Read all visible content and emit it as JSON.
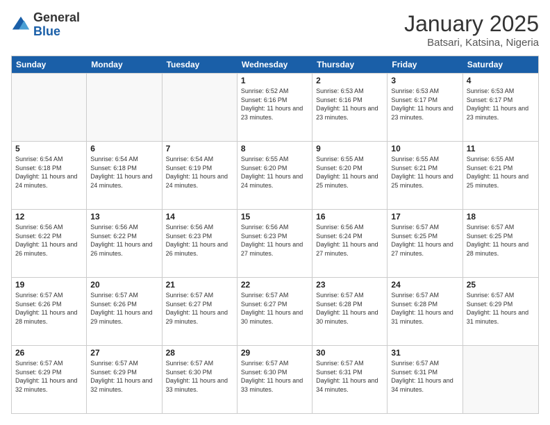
{
  "logo": {
    "general": "General",
    "blue": "Blue"
  },
  "header": {
    "title": "January 2025",
    "subtitle": "Batsari, Katsina, Nigeria"
  },
  "days": [
    "Sunday",
    "Monday",
    "Tuesday",
    "Wednesday",
    "Thursday",
    "Friday",
    "Saturday"
  ],
  "weeks": [
    [
      {
        "date": "",
        "sunrise": "",
        "sunset": "",
        "daylight": ""
      },
      {
        "date": "",
        "sunrise": "",
        "sunset": "",
        "daylight": ""
      },
      {
        "date": "",
        "sunrise": "",
        "sunset": "",
        "daylight": ""
      },
      {
        "date": "1",
        "sunrise": "Sunrise: 6:52 AM",
        "sunset": "Sunset: 6:16 PM",
        "daylight": "Daylight: 11 hours and 23 minutes."
      },
      {
        "date": "2",
        "sunrise": "Sunrise: 6:53 AM",
        "sunset": "Sunset: 6:16 PM",
        "daylight": "Daylight: 11 hours and 23 minutes."
      },
      {
        "date": "3",
        "sunrise": "Sunrise: 6:53 AM",
        "sunset": "Sunset: 6:17 PM",
        "daylight": "Daylight: 11 hours and 23 minutes."
      },
      {
        "date": "4",
        "sunrise": "Sunrise: 6:53 AM",
        "sunset": "Sunset: 6:17 PM",
        "daylight": "Daylight: 11 hours and 23 minutes."
      }
    ],
    [
      {
        "date": "5",
        "sunrise": "Sunrise: 6:54 AM",
        "sunset": "Sunset: 6:18 PM",
        "daylight": "Daylight: 11 hours and 24 minutes."
      },
      {
        "date": "6",
        "sunrise": "Sunrise: 6:54 AM",
        "sunset": "Sunset: 6:18 PM",
        "daylight": "Daylight: 11 hours and 24 minutes."
      },
      {
        "date": "7",
        "sunrise": "Sunrise: 6:54 AM",
        "sunset": "Sunset: 6:19 PM",
        "daylight": "Daylight: 11 hours and 24 minutes."
      },
      {
        "date": "8",
        "sunrise": "Sunrise: 6:55 AM",
        "sunset": "Sunset: 6:20 PM",
        "daylight": "Daylight: 11 hours and 24 minutes."
      },
      {
        "date": "9",
        "sunrise": "Sunrise: 6:55 AM",
        "sunset": "Sunset: 6:20 PM",
        "daylight": "Daylight: 11 hours and 25 minutes."
      },
      {
        "date": "10",
        "sunrise": "Sunrise: 6:55 AM",
        "sunset": "Sunset: 6:21 PM",
        "daylight": "Daylight: 11 hours and 25 minutes."
      },
      {
        "date": "11",
        "sunrise": "Sunrise: 6:55 AM",
        "sunset": "Sunset: 6:21 PM",
        "daylight": "Daylight: 11 hours and 25 minutes."
      }
    ],
    [
      {
        "date": "12",
        "sunrise": "Sunrise: 6:56 AM",
        "sunset": "Sunset: 6:22 PM",
        "daylight": "Daylight: 11 hours and 26 minutes."
      },
      {
        "date": "13",
        "sunrise": "Sunrise: 6:56 AM",
        "sunset": "Sunset: 6:22 PM",
        "daylight": "Daylight: 11 hours and 26 minutes."
      },
      {
        "date": "14",
        "sunrise": "Sunrise: 6:56 AM",
        "sunset": "Sunset: 6:23 PM",
        "daylight": "Daylight: 11 hours and 26 minutes."
      },
      {
        "date": "15",
        "sunrise": "Sunrise: 6:56 AM",
        "sunset": "Sunset: 6:23 PM",
        "daylight": "Daylight: 11 hours and 27 minutes."
      },
      {
        "date": "16",
        "sunrise": "Sunrise: 6:56 AM",
        "sunset": "Sunset: 6:24 PM",
        "daylight": "Daylight: 11 hours and 27 minutes."
      },
      {
        "date": "17",
        "sunrise": "Sunrise: 6:57 AM",
        "sunset": "Sunset: 6:25 PM",
        "daylight": "Daylight: 11 hours and 27 minutes."
      },
      {
        "date": "18",
        "sunrise": "Sunrise: 6:57 AM",
        "sunset": "Sunset: 6:25 PM",
        "daylight": "Daylight: 11 hours and 28 minutes."
      }
    ],
    [
      {
        "date": "19",
        "sunrise": "Sunrise: 6:57 AM",
        "sunset": "Sunset: 6:26 PM",
        "daylight": "Daylight: 11 hours and 28 minutes."
      },
      {
        "date": "20",
        "sunrise": "Sunrise: 6:57 AM",
        "sunset": "Sunset: 6:26 PM",
        "daylight": "Daylight: 11 hours and 29 minutes."
      },
      {
        "date": "21",
        "sunrise": "Sunrise: 6:57 AM",
        "sunset": "Sunset: 6:27 PM",
        "daylight": "Daylight: 11 hours and 29 minutes."
      },
      {
        "date": "22",
        "sunrise": "Sunrise: 6:57 AM",
        "sunset": "Sunset: 6:27 PM",
        "daylight": "Daylight: 11 hours and 30 minutes."
      },
      {
        "date": "23",
        "sunrise": "Sunrise: 6:57 AM",
        "sunset": "Sunset: 6:28 PM",
        "daylight": "Daylight: 11 hours and 30 minutes."
      },
      {
        "date": "24",
        "sunrise": "Sunrise: 6:57 AM",
        "sunset": "Sunset: 6:28 PM",
        "daylight": "Daylight: 11 hours and 31 minutes."
      },
      {
        "date": "25",
        "sunrise": "Sunrise: 6:57 AM",
        "sunset": "Sunset: 6:29 PM",
        "daylight": "Daylight: 11 hours and 31 minutes."
      }
    ],
    [
      {
        "date": "26",
        "sunrise": "Sunrise: 6:57 AM",
        "sunset": "Sunset: 6:29 PM",
        "daylight": "Daylight: 11 hours and 32 minutes."
      },
      {
        "date": "27",
        "sunrise": "Sunrise: 6:57 AM",
        "sunset": "Sunset: 6:29 PM",
        "daylight": "Daylight: 11 hours and 32 minutes."
      },
      {
        "date": "28",
        "sunrise": "Sunrise: 6:57 AM",
        "sunset": "Sunset: 6:30 PM",
        "daylight": "Daylight: 11 hours and 33 minutes."
      },
      {
        "date": "29",
        "sunrise": "Sunrise: 6:57 AM",
        "sunset": "Sunset: 6:30 PM",
        "daylight": "Daylight: 11 hours and 33 minutes."
      },
      {
        "date": "30",
        "sunrise": "Sunrise: 6:57 AM",
        "sunset": "Sunset: 6:31 PM",
        "daylight": "Daylight: 11 hours and 34 minutes."
      },
      {
        "date": "31",
        "sunrise": "Sunrise: 6:57 AM",
        "sunset": "Sunset: 6:31 PM",
        "daylight": "Daylight: 11 hours and 34 minutes."
      },
      {
        "date": "",
        "sunrise": "",
        "sunset": "",
        "daylight": ""
      }
    ]
  ]
}
